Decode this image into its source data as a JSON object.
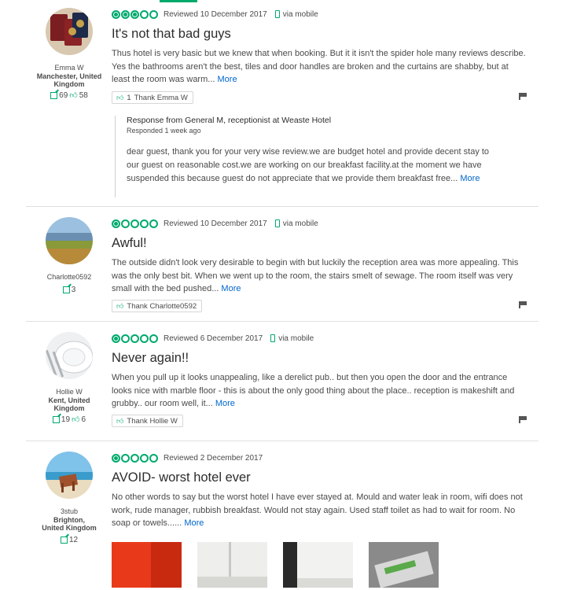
{
  "reviews": [
    {
      "username": "Emma W",
      "location": "Manchester, United Kingdom",
      "review_count": "69",
      "helpful_count": "58",
      "rating": 3,
      "reviewed": "Reviewed 10 December 2017",
      "via": "via mobile",
      "title": "It's not that bad guys",
      "body": "Thus hotel is very basic but we knew that when booking. But it it isn't the spider hole many reviews describe. Yes the bathrooms aren't the best, tiles and door handles are broken and the curtains are shabby, but at least the room was warm...",
      "more": "More",
      "thank_count": "1",
      "thank_label": "Thank Emma W",
      "response": {
        "from": "Response from General M, receptionist at Weaste Hotel",
        "when": "Responded 1 week ago",
        "body": "dear guest, thank you for your very wise review.we are budget hotel and provide decent stay to our guest on reasonable cost.we are working on our breakfast facility.at the moment we have suspended this because guest do not appreciate that we provide them breakfast free...",
        "more": "More"
      }
    },
    {
      "username": "Charlotte0592",
      "location": "",
      "review_count": "3",
      "helpful_count": "",
      "rating": 1,
      "reviewed": "Reviewed 10 December 2017",
      "via": "via mobile",
      "title": "Awful!",
      "body": "The outside didn't look very desirable to begin with but luckily the reception area was more appealing. This was the only best bit. When we went up to the room, the stairs smelt of sewage. The room itself was very small with the bed pushed...",
      "more": "More",
      "thank_label": "Thank Charlotte0592"
    },
    {
      "username": "Hollie W",
      "location": "Kent, United Kingdom",
      "review_count": "19",
      "helpful_count": "6",
      "rating": 1,
      "reviewed": "Reviewed 6 December 2017",
      "via": "via mobile",
      "title": "Never again!!",
      "body": "When you pull up it looks unappealing, like a derelict pub.. but then you open the door and the entrance looks nice with marble floor - this is about the only good thing about the place.. reception is makeshift and grubby.. our room well, it...",
      "more": "More",
      "thank_label": "Thank Hollie W"
    },
    {
      "username": "3stub",
      "location": "Brighton, United Kingdom",
      "review_count": "12",
      "helpful_count": "",
      "rating": 1,
      "reviewed": "Reviewed 2 December 2017",
      "title": "AVOID- worst hotel ever",
      "body": "No other words to say but the worst hotel I have ever stayed at. Mould and water leak in room, wifi does not work, rude manager, rubbish breakfast. Would not stay again. Used staff toilet as had to wait for room. No soap or towels......",
      "more": "More"
    }
  ],
  "colors": {
    "accent": "#00aa6c",
    "link": "#0066cc"
  }
}
